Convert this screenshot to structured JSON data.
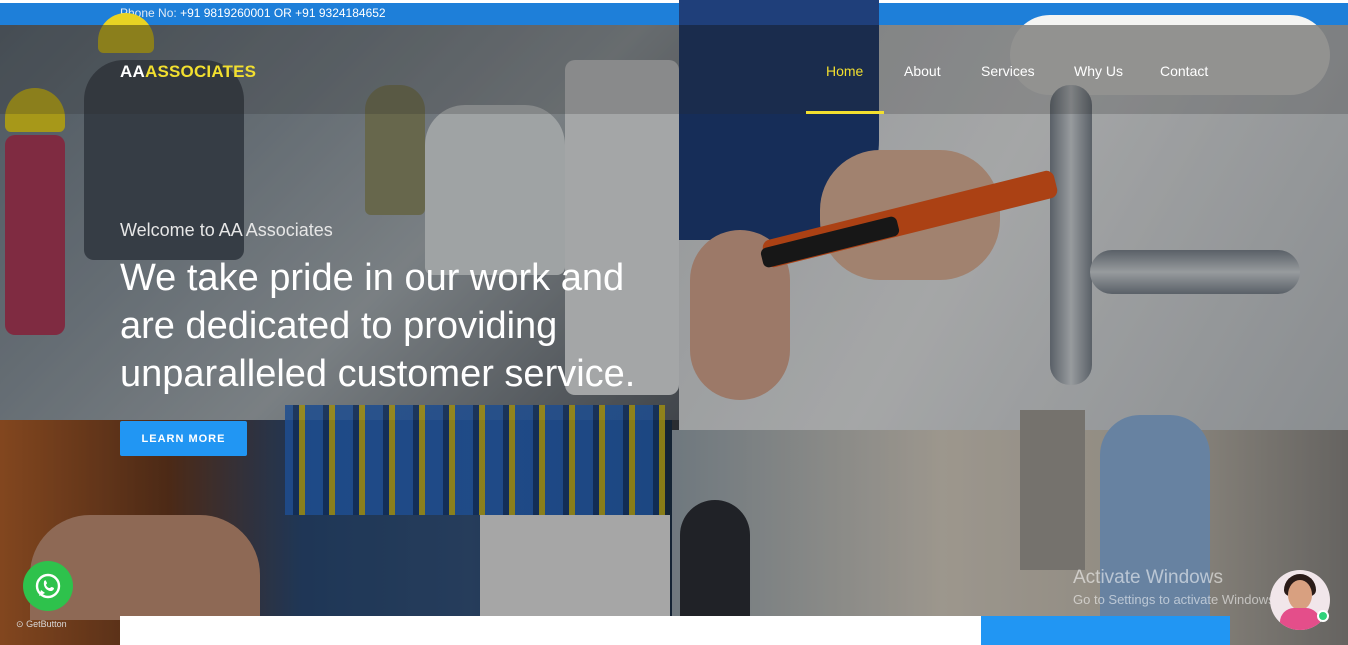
{
  "topbar": {
    "phone_label": "Phone No:",
    "phone_numbers": "+91 9819260001 OR +91 9324184652"
  },
  "logo": {
    "part1": "AA",
    "part2": "ASSOCIATES"
  },
  "nav": {
    "items": [
      {
        "label": "Home",
        "active": true
      },
      {
        "label": "About",
        "active": false
      },
      {
        "label": "Services",
        "active": false
      },
      {
        "label": "Why Us",
        "active": false
      },
      {
        "label": "Contact",
        "active": false
      }
    ]
  },
  "hero": {
    "welcome": "Welcome to AA Associates",
    "headline": "We take pride in our work and are dedicated to providing unparalleled customer service.",
    "cta_label": "LEARN MORE"
  },
  "widgets": {
    "getbutton_label": "GetButton"
  },
  "windows_watermark": {
    "title": "Activate Windows",
    "subtitle": "Go to Settings to activate Windows."
  },
  "colors": {
    "topbar": "#1e7fd9",
    "accent_yellow": "#f2df2f",
    "button_blue": "#2196f3",
    "whatsapp_green": "#2ec24c"
  }
}
